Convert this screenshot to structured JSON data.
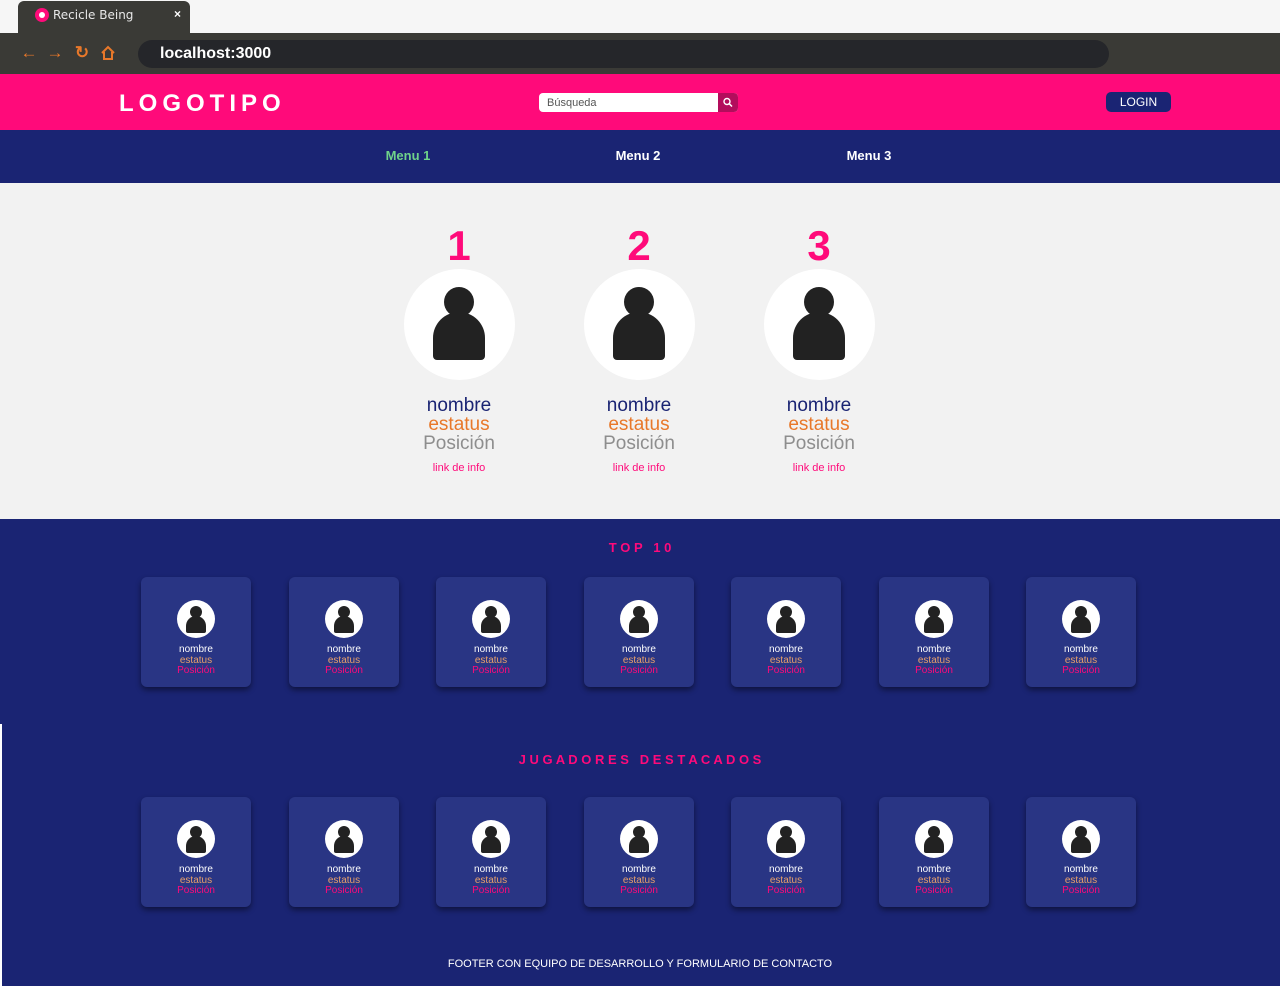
{
  "browser": {
    "tab_title": "Recicle Being",
    "tab_close": "×",
    "url": "localhost:3000"
  },
  "header": {
    "logo": "LOGOTIPO",
    "search_placeholder": "Búsqueda",
    "login_label": "LOGIN"
  },
  "menu": [
    "Menu 1",
    "Menu 2",
    "Menu 3"
  ],
  "podium": [
    {
      "rank": "1",
      "name": "nombre",
      "status": "estatus",
      "position": "Posición",
      "link": "link de info"
    },
    {
      "rank": "2",
      "name": "nombre",
      "status": "estatus",
      "position": "Posición",
      "link": "link de info"
    },
    {
      "rank": "3",
      "name": "nombre",
      "status": "estatus",
      "position": "Posición",
      "link": "link de info"
    }
  ],
  "top10": {
    "title": "T O P   1 0",
    "cards": [
      {
        "name": "nombre",
        "status": "estatus",
        "position": "Posición"
      },
      {
        "name": "nombre",
        "status": "estatus",
        "position": "Posición"
      },
      {
        "name": "nombre",
        "status": "estatus",
        "position": "Posición"
      },
      {
        "name": "nombre",
        "status": "estatus",
        "position": "Posición"
      },
      {
        "name": "nombre",
        "status": "estatus",
        "position": "Posición"
      },
      {
        "name": "nombre",
        "status": "estatus",
        "position": "Posición"
      },
      {
        "name": "nombre",
        "status": "estatus",
        "position": "Posición"
      }
    ]
  },
  "featured": {
    "title": "J U G A D O R E S   D E S T A C A D O S",
    "cards": [
      {
        "name": "nombre",
        "status": "estatus",
        "position": "Posición"
      },
      {
        "name": "nombre",
        "status": "estatus",
        "position": "Posición"
      },
      {
        "name": "nombre",
        "status": "estatus",
        "position": "Posición"
      },
      {
        "name": "nombre",
        "status": "estatus",
        "position": "Posición"
      },
      {
        "name": "nombre",
        "status": "estatus",
        "position": "Posición"
      },
      {
        "name": "nombre",
        "status": "estatus",
        "position": "Posición"
      },
      {
        "name": "nombre",
        "status": "estatus",
        "position": "Posición"
      }
    ]
  },
  "footer": "FOOTER CON EQUIPO DE DESARROLLO Y FORMULARIO DE CONTACTO",
  "colors": {
    "accent": "#ff0a7a",
    "navy": "#1a2473",
    "active_menu": "#6fd38a",
    "status": "#e8782a"
  }
}
